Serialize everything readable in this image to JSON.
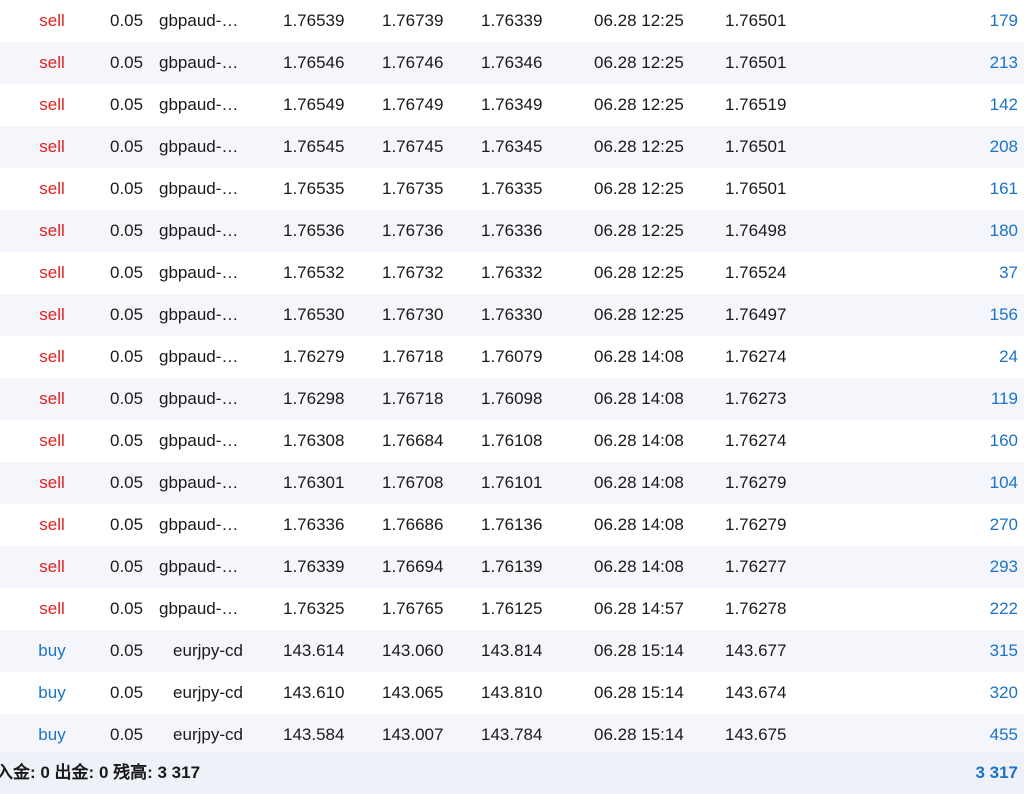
{
  "rows": [
    {
      "type": "sell",
      "volume": "0.05",
      "symbol": "gbpaud-…",
      "open_price": "1.76539",
      "sl": "1.76739",
      "tp": "1.76339",
      "time": "06.28 12:25",
      "current": "1.76501",
      "profit": "179"
    },
    {
      "type": "sell",
      "volume": "0.05",
      "symbol": "gbpaud-…",
      "open_price": "1.76546",
      "sl": "1.76746",
      "tp": "1.76346",
      "time": "06.28 12:25",
      "current": "1.76501",
      "profit": "213"
    },
    {
      "type": "sell",
      "volume": "0.05",
      "symbol": "gbpaud-…",
      "open_price": "1.76549",
      "sl": "1.76749",
      "tp": "1.76349",
      "time": "06.28 12:25",
      "current": "1.76519",
      "profit": "142"
    },
    {
      "type": "sell",
      "volume": "0.05",
      "symbol": "gbpaud-…",
      "open_price": "1.76545",
      "sl": "1.76745",
      "tp": "1.76345",
      "time": "06.28 12:25",
      "current": "1.76501",
      "profit": "208"
    },
    {
      "type": "sell",
      "volume": "0.05",
      "symbol": "gbpaud-…",
      "open_price": "1.76535",
      "sl": "1.76735",
      "tp": "1.76335",
      "time": "06.28 12:25",
      "current": "1.76501",
      "profit": "161"
    },
    {
      "type": "sell",
      "volume": "0.05",
      "symbol": "gbpaud-…",
      "open_price": "1.76536",
      "sl": "1.76736",
      "tp": "1.76336",
      "time": "06.28 12:25",
      "current": "1.76498",
      "profit": "180"
    },
    {
      "type": "sell",
      "volume": "0.05",
      "symbol": "gbpaud-…",
      "open_price": "1.76532",
      "sl": "1.76732",
      "tp": "1.76332",
      "time": "06.28 12:25",
      "current": "1.76524",
      "profit": "37"
    },
    {
      "type": "sell",
      "volume": "0.05",
      "symbol": "gbpaud-…",
      "open_price": "1.76530",
      "sl": "1.76730",
      "tp": "1.76330",
      "time": "06.28 12:25",
      "current": "1.76497",
      "profit": "156"
    },
    {
      "type": "sell",
      "volume": "0.05",
      "symbol": "gbpaud-…",
      "open_price": "1.76279",
      "sl": "1.76718",
      "tp": "1.76079",
      "time": "06.28 14:08",
      "current": "1.76274",
      "profit": "24"
    },
    {
      "type": "sell",
      "volume": "0.05",
      "symbol": "gbpaud-…",
      "open_price": "1.76298",
      "sl": "1.76718",
      "tp": "1.76098",
      "time": "06.28 14:08",
      "current": "1.76273",
      "profit": "119"
    },
    {
      "type": "sell",
      "volume": "0.05",
      "symbol": "gbpaud-…",
      "open_price": "1.76308",
      "sl": "1.76684",
      "tp": "1.76108",
      "time": "06.28 14:08",
      "current": "1.76274",
      "profit": "160"
    },
    {
      "type": "sell",
      "volume": "0.05",
      "symbol": "gbpaud-…",
      "open_price": "1.76301",
      "sl": "1.76708",
      "tp": "1.76101",
      "time": "06.28 14:08",
      "current": "1.76279",
      "profit": "104"
    },
    {
      "type": "sell",
      "volume": "0.05",
      "symbol": "gbpaud-…",
      "open_price": "1.76336",
      "sl": "1.76686",
      "tp": "1.76136",
      "time": "06.28 14:08",
      "current": "1.76279",
      "profit": "270"
    },
    {
      "type": "sell",
      "volume": "0.05",
      "symbol": "gbpaud-…",
      "open_price": "1.76339",
      "sl": "1.76694",
      "tp": "1.76139",
      "time": "06.28 14:08",
      "current": "1.76277",
      "profit": "293"
    },
    {
      "type": "sell",
      "volume": "0.05",
      "symbol": "gbpaud-…",
      "open_price": "1.76325",
      "sl": "1.76765",
      "tp": "1.76125",
      "time": "06.28 14:57",
      "current": "1.76278",
      "profit": "222"
    },
    {
      "type": "buy",
      "volume": "0.05",
      "symbol": "eurjpy-cd",
      "open_price": "143.614",
      "sl": "143.060",
      "tp": "143.814",
      "time": "06.28 15:14",
      "current": "143.677",
      "profit": "315"
    },
    {
      "type": "buy",
      "volume": "0.05",
      "symbol": "eurjpy-cd",
      "open_price": "143.610",
      "sl": "143.065",
      "tp": "143.810",
      "time": "06.28 15:14",
      "current": "143.674",
      "profit": "320"
    },
    {
      "type": "buy",
      "volume": "0.05",
      "symbol": "eurjpy-cd",
      "open_price": "143.584",
      "sl": "143.007",
      "tp": "143.784",
      "time": "06.28 15:14",
      "current": "143.675",
      "profit": "455"
    }
  ],
  "footer": {
    "summary": "入金: 0 出金: 0 残高: 3 317",
    "total_profit": "3 317"
  },
  "colors": {
    "sell": "#e02020",
    "buy": "#1a73c8",
    "profit": "#1a73c8",
    "row_alt": "#f4f6fb",
    "footer_bg": "#eef1f7"
  }
}
